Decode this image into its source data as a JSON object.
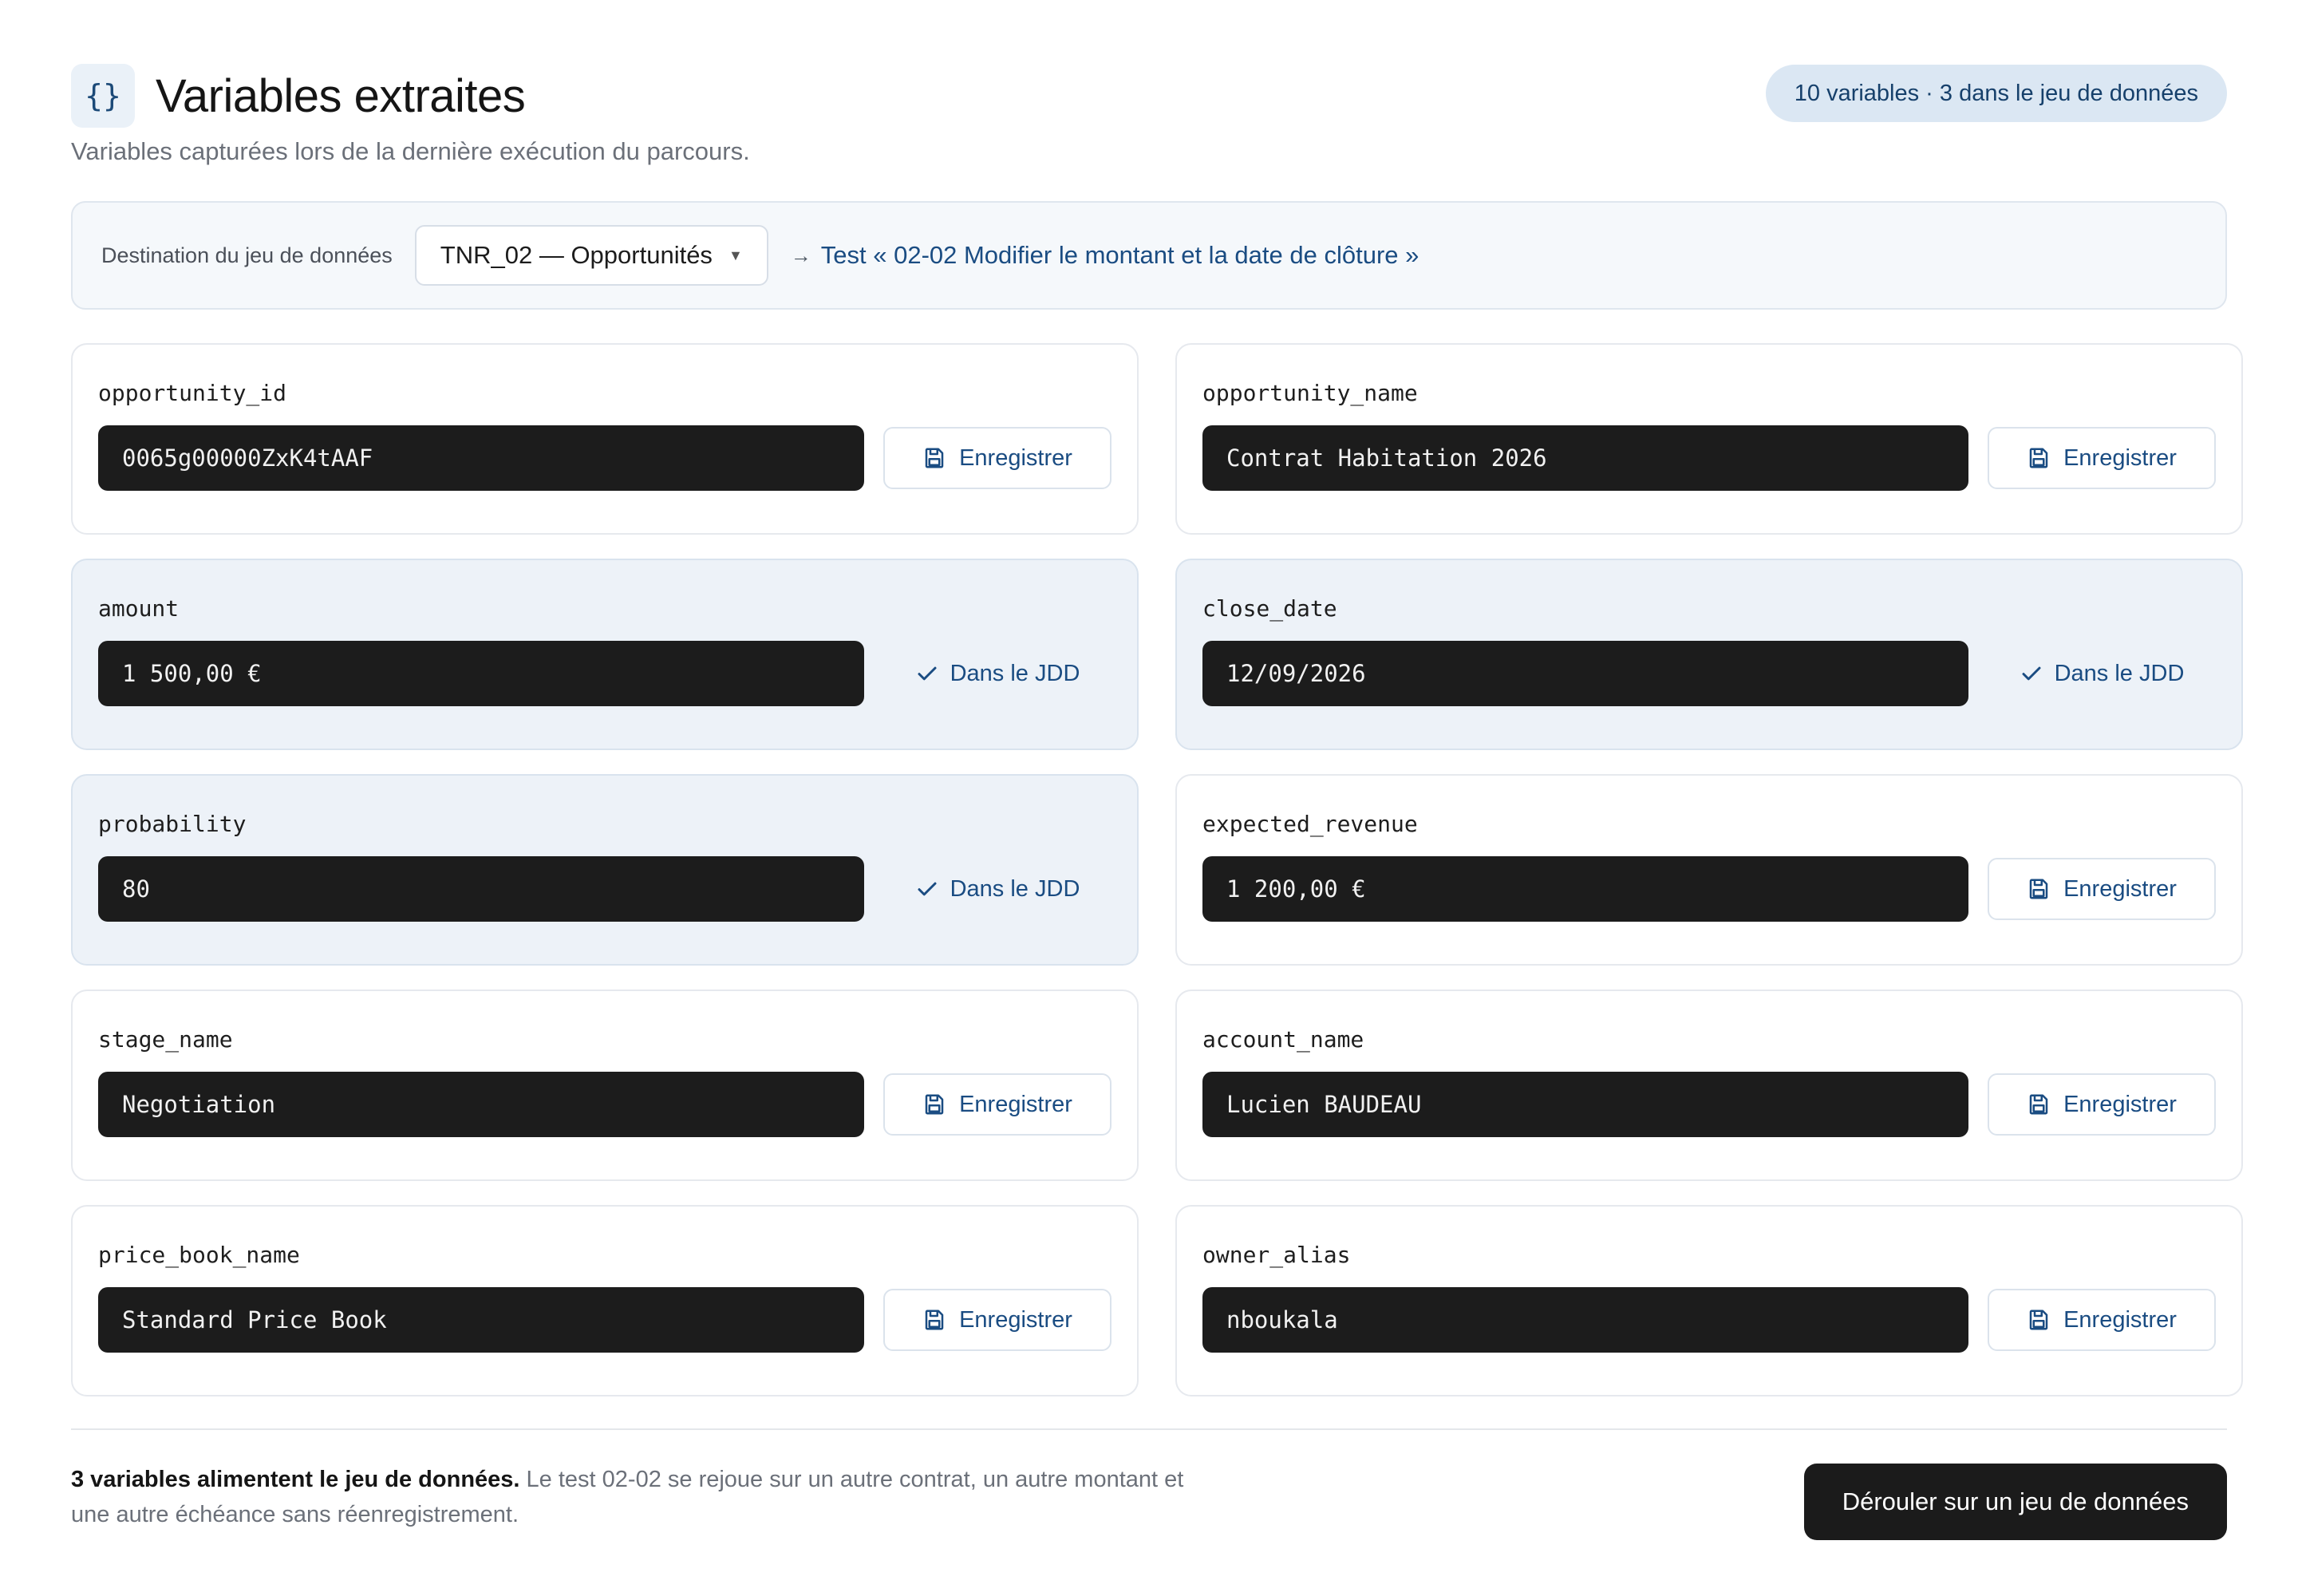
{
  "header": {
    "icon_glyph": "{}",
    "title": "Variables extraites",
    "subtitle": "Variables capturées lors de la dernière exécution du parcours.",
    "count_badge": "10 variables · 3 dans le jeu de données"
  },
  "destination": {
    "label": "Destination du jeu de données",
    "selected": "TNR_02 — Opportunités",
    "link": "Test « 02-02 Modifier le montant et la date de clôture »"
  },
  "variables": [
    {
      "name": "opportunity_id",
      "value": "0065g00000ZxK4tAAF",
      "in_jdd": false,
      "action": "Enregistrer"
    },
    {
      "name": "opportunity_name",
      "value": "Contrat Habitation 2026",
      "in_jdd": false,
      "action": "Enregistrer"
    },
    {
      "name": "amount",
      "value": "1 500,00 €",
      "in_jdd": true,
      "action": "Dans le JDD"
    },
    {
      "name": "close_date",
      "value": "12/09/2026",
      "in_jdd": true,
      "action": "Dans le JDD"
    },
    {
      "name": "probability",
      "value": "80",
      "in_jdd": true,
      "action": "Dans le JDD"
    },
    {
      "name": "expected_revenue",
      "value": "1 200,00 €",
      "in_jdd": false,
      "action": "Enregistrer"
    },
    {
      "name": "stage_name",
      "value": "Negotiation",
      "in_jdd": false,
      "action": "Enregistrer"
    },
    {
      "name": "account_name",
      "value": "Lucien BAUDEAU",
      "in_jdd": false,
      "action": "Enregistrer"
    },
    {
      "name": "price_book_name",
      "value": "Standard Price Book",
      "in_jdd": false,
      "action": "Enregistrer"
    },
    {
      "name": "owner_alias",
      "value": "nboukala",
      "in_jdd": false,
      "action": "Enregistrer"
    }
  ],
  "footer": {
    "summary_bold": "3 variables alimentent le jeu de données.",
    "summary_text": " Le test 02-02 se rejoue sur un autre contrat, un autre montant et une autre échéance sans réenregistrement.",
    "run_button": "Dérouler sur un jeu de données"
  },
  "colors": {
    "accent": "#1a4c82",
    "badge_bg": "#dbe7f3",
    "value_bg": "#1c1c1c",
    "jdd_card_bg": "#edf2f8"
  }
}
